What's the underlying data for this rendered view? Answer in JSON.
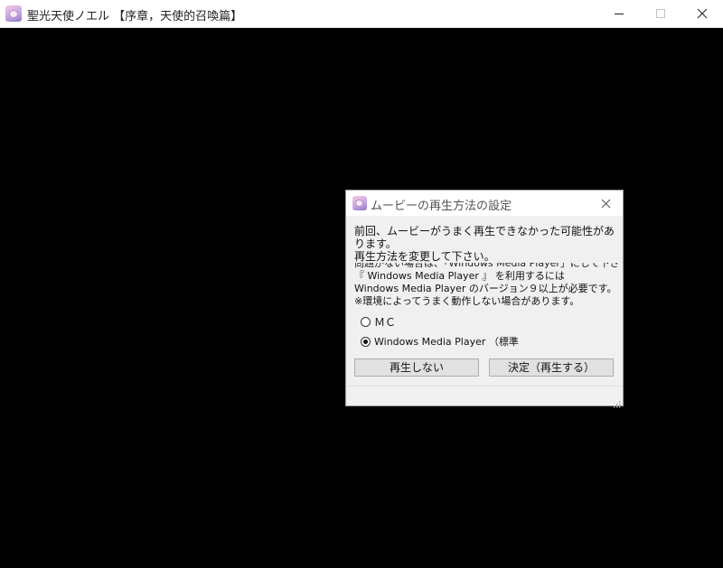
{
  "window": {
    "title": "聖光天使ノエル 【序章，天使的召喚篇】",
    "controls": {
      "minimize": "minimize-icon",
      "maximize": "maximize-icon",
      "close": "close-icon"
    }
  },
  "dialog": {
    "title": "ムービーの再生方法の設定",
    "message_lines": [
      "前回、ムービーがうまく再生できなかった可能性があ",
      "ります。",
      "再生方法を変更して下さい。"
    ],
    "clipped_line": "問題がない場合は、「Windows Media Player」にして下さ",
    "wmp_note_lines": [
      "『 Windows Media Player 』 を利用するには",
      "Windows Media Player のバージョン９以上が必要です。",
      "※環境によってうまく動作しない場合があります。"
    ],
    "options": [
      {
        "label": "ＭＣ",
        "selected": false
      },
      {
        "label": "Windows Media Player （標準",
        "selected": true
      }
    ],
    "buttons": {
      "skip": "再生しない",
      "ok": "決定（再生する）"
    }
  },
  "colors": {
    "background": "#000000",
    "dialog_bg": "#f0f0f0",
    "button_bg": "#e1e1e1"
  }
}
